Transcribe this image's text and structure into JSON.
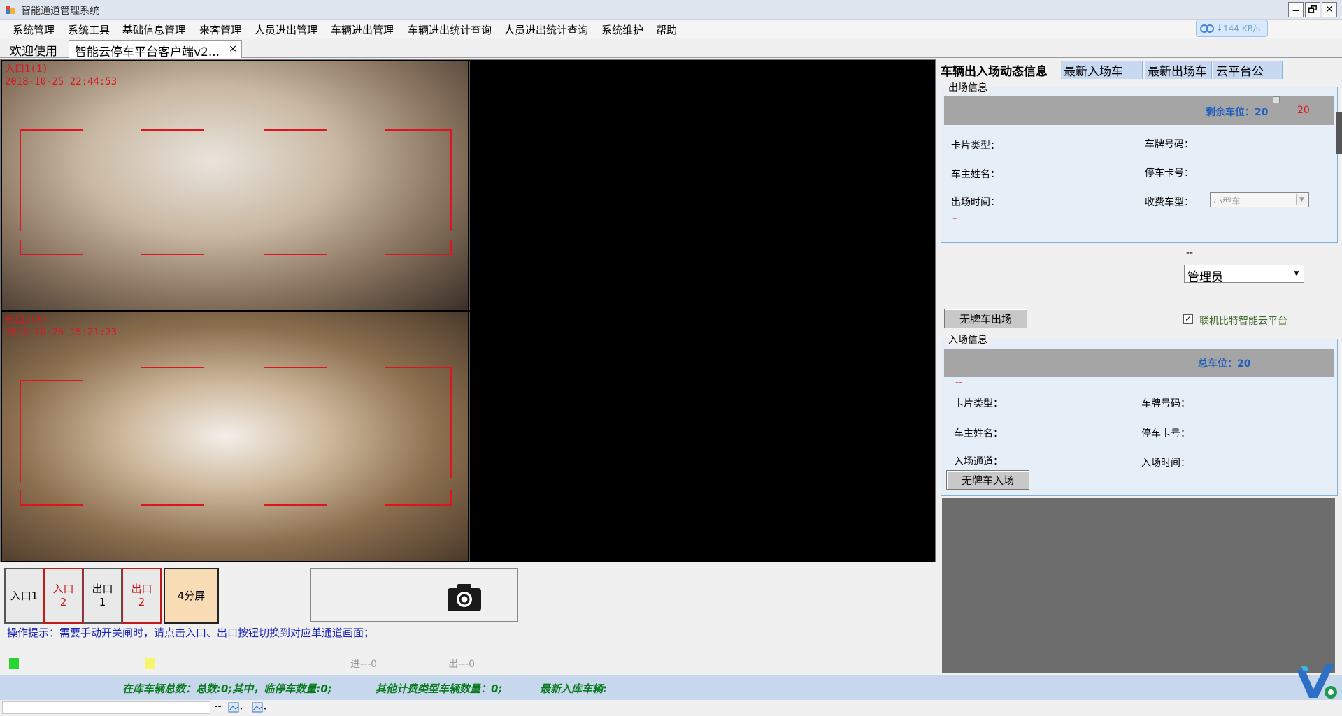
{
  "window": {
    "title": "智能通道管理系统",
    "minimize": "🗕",
    "maximize": "🗗",
    "close": "✕"
  },
  "menu": [
    "系统管理",
    "系统工具",
    "基础信息管理",
    "来客管理",
    "人员进出管理",
    "车辆进出管理",
    "车辆进出统计查询",
    "人员进出统计查询",
    "系统维护",
    "帮助"
  ],
  "net_speed": "144 KB/s",
  "tabs": {
    "welcome": "欢迎使用",
    "client": "智能云停车平台客户端v2...",
    "client_close": "×"
  },
  "cameras": {
    "cam1_name": "入口1(1)",
    "cam1_time": "2018-10-25 22:44:53",
    "cam2_name": "出口2(X)",
    "cam2_time": "2018-10-25 15:21:23"
  },
  "channel_buttons": [
    {
      "line1": "入口1",
      "line2": ""
    },
    {
      "line1": "入口",
      "line2": "2"
    },
    {
      "line1": "出口",
      "line2": "1"
    },
    {
      "line1": "出口",
      "line2": "2"
    }
  ],
  "split_button": "4分屏",
  "hint": "操作提示：需要手动开关闸时，请点击入口、出口按钮切换到对应单通道画面；",
  "indicators": {
    "green": "-",
    "yellow": "-",
    "in_count": "进---0",
    "out_count": "出---0"
  },
  "right_tabs": [
    "车辆出入场动态信息",
    "最新入场车",
    "最新出场车",
    "云平台公"
  ],
  "exit_info": {
    "title": "出场信息",
    "remaining_label": "剩余车位：20",
    "remaining_red": "20",
    "card_type": "卡片类型：",
    "plate_no": "车牌号码：",
    "owner": "车主姓名：",
    "park_card": "停车卡号：",
    "exit_time": "出场时间：",
    "fee_type": "收费车型：",
    "fee_type_value": "小型车",
    "red_dash": "–"
  },
  "operator": {
    "dash": "--",
    "value": "管理员"
  },
  "no_plate_exit": "无牌车出场",
  "cloud_checkbox": {
    "label": "联机比特智能云平台",
    "checked": "✓"
  },
  "entry_info": {
    "title": "入场信息",
    "total_label": "总车位：20",
    "red_dash": "--",
    "card_type": "卡片类型：",
    "plate_no": "车牌号码：",
    "owner": "车主姓名：",
    "park_card": "停车卡号：",
    "entry_channel": "入场通道：",
    "entry_time": "入场时间：",
    "no_plate_entry": "无牌车入场"
  },
  "status": {
    "total": "在库车辆总数：总数:0;其中，临停车数量:0;",
    "other": "其他计费类型车辆数量：0;",
    "latest": "最新入库车辆:"
  },
  "bottom": {
    "dash": "--"
  },
  "colors": {
    "accent_red": "#e0141e",
    "status_green": "#0a7a1f",
    "hint_blue": "#1a24b8",
    "split_bg": "#f8dcb6"
  }
}
